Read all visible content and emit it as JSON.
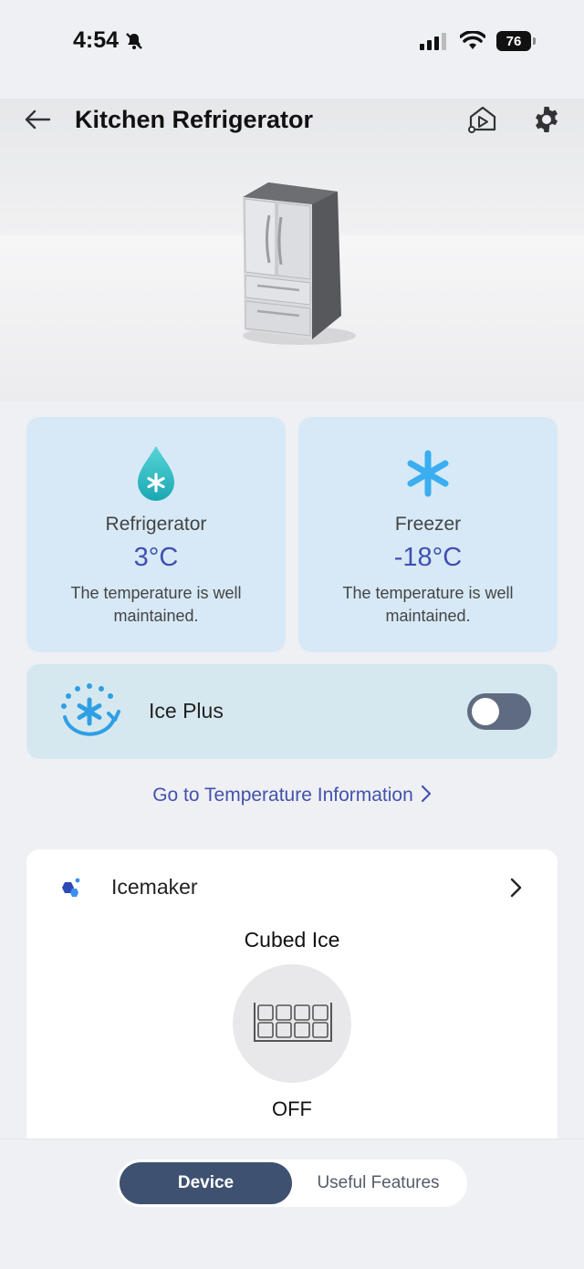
{
  "status_bar": {
    "time": "4:54",
    "battery": "76"
  },
  "header": {
    "title": "Kitchen Refrigerator"
  },
  "compartments": [
    {
      "label": "Refrigerator",
      "temperature": "3°C",
      "description": "The temperature is well maintained.",
      "icon": "water-drop-icon"
    },
    {
      "label": "Freezer",
      "temperature": "-18°C",
      "description": "The temperature is well maintained.",
      "icon": "snowflake-icon"
    }
  ],
  "ice_plus": {
    "label": "Ice Plus",
    "enabled": false
  },
  "temperature_link": "Go to Temperature Information",
  "icemaker": {
    "title": "Icemaker",
    "mode": "Cubed Ice",
    "status": "OFF"
  },
  "tabs": {
    "device": "Device",
    "useful_features": "Useful Features"
  },
  "colors": {
    "accent": "#4050b0",
    "card_blue": "#d7e9f6",
    "tab_active": "#3f5170"
  }
}
